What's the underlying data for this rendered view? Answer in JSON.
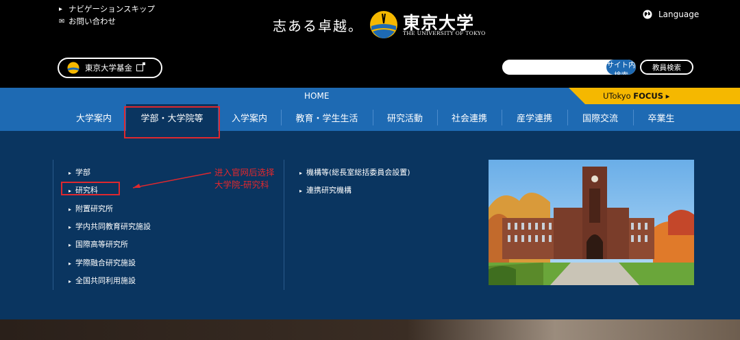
{
  "header": {
    "skip_nav": "ナビゲーションスキップ",
    "contact": "お問い合わせ",
    "tagline": "志ある卓越。",
    "logo_ja": "東京大学",
    "logo_en": "THE UNIVERSITY OF TOKYO",
    "language": "Language",
    "fund_button": "東京大学基金",
    "search": {
      "placeholder": "",
      "site_search": "サイト内検索",
      "faculty_search": "教員検索"
    }
  },
  "home_bar": {
    "home": "HOME",
    "focus_prefix": "UTokyo ",
    "focus_bold": "FOCUS"
  },
  "nav": {
    "items": [
      "大学案内",
      "学部・大学院等",
      "入学案内",
      "教育・学生生活",
      "研究活動",
      "社会連携",
      "産学連携",
      "国際交流",
      "卒業生"
    ],
    "active_index": 1
  },
  "dropdown": {
    "col1": [
      "学部",
      "研究科",
      "附置研究所",
      "学内共同教育研究施設",
      "国際高等研究所",
      "学際融合研究施設",
      "全国共同利用施設"
    ],
    "col2": [
      "機構等(総長室総括委員会設置)",
      "連携研究機構"
    ]
  },
  "annotation": {
    "line1": "进入官网后选择",
    "line2": "大学院-研究科"
  },
  "colors": {
    "nav_blue": "#1e6ab3",
    "dark_navy": "#0a3560",
    "focus_yellow": "#f5b800",
    "annotation_red": "#e0282e"
  }
}
